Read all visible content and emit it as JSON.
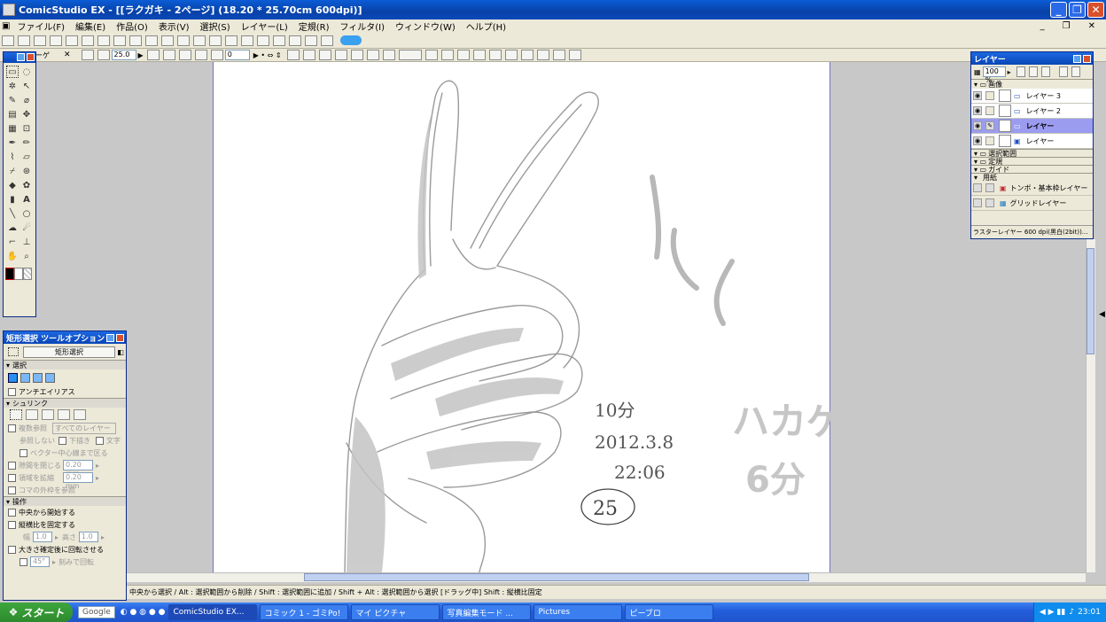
{
  "window": {
    "title": "ComicStudio EX - [[ラクガキ - 2ページ] (18.20 * 25.70cm 600dpi)]"
  },
  "menu": [
    "ファイル(F)",
    "編集(E)",
    "作品(O)",
    "表示(V)",
    "選択(S)",
    "レイヤー(L)",
    "定規(R)",
    "フィルタ(I)",
    "ウィンドウ(W)",
    "ヘルプ(H)"
  ],
  "toolbar2": {
    "zoom": "25.0",
    "rotate": "0",
    "tab_label": "ーゲ"
  },
  "layers_panel": {
    "title": "レイヤー",
    "opacity": "100 %",
    "group_image": "画像",
    "layers": [
      {
        "name": "レイヤー 3",
        "selected": false
      },
      {
        "name": "レイヤー 2",
        "selected": false
      },
      {
        "name": "レイヤー",
        "selected": true
      },
      {
        "name": "レイヤー",
        "selected": false
      }
    ],
    "sections": [
      "選択範囲",
      "定規",
      "ガイド",
      "用紙"
    ],
    "paper_layers": [
      "トンボ・基本枠レイヤー",
      "グリッドレイヤー"
    ],
    "footer": "ラスターレイヤー 600 dpi(黒白(2bit))..."
  },
  "tool_options": {
    "title": "矩形選択 ツールオプション",
    "tool_name": "矩形選択",
    "section_select": "選択",
    "antialias": "アンチエイリアス",
    "section_snap": "シュリンク",
    "multi_ref": "複数参照",
    "all_layers": "すべてのレイヤー",
    "no_ref": "参照しない",
    "underdraw": "下描き",
    "text": "文字",
    "vector_center": "ベクター中心線まで区る",
    "close_gap": "隙間を閉じる",
    "gap_val": "0.20 mm",
    "expand": "領域を拡縮",
    "expand_val": "0.20 mm",
    "frame_ref": "コマの外枠を参照",
    "section_op": "操作",
    "from_center": "中央から開始する",
    "fix_ratio": "縦横比を固定する",
    "w_label": "幅",
    "w_val": "1.0",
    "h_label": "高さ",
    "h_val": "1.0",
    "rotate_after": "大きさ確定後に回転させる",
    "angle_val": "45°",
    "snap_rotate": "刻みで回転"
  },
  "status": "中央から選択 / Alt : 選択範囲から削除 / Shift : 選択範囲に追加 / Shift + Alt : 選択範囲から選択 [ドラッグ中] Shift : 縦横比固定",
  "canvas_text": {
    "time1": "10分",
    "date": "2012.3.8",
    "time": "22:06",
    "circle": "25",
    "label_big": "ハカゲ",
    "min6": "6分"
  },
  "taskbar": {
    "start": "スタート",
    "search": "Google",
    "tasks": [
      "ComicStudio EX...",
      "コミック 1 - ゴミPo!",
      "マイ ピクチャ",
      "写真編集モード ...",
      "Pictures",
      "ピーブロ"
    ],
    "clock": "23:01"
  },
  "colors": {
    "title": "#0842a8",
    "accent": "#9b9cf0",
    "face": "#ece9d8"
  }
}
